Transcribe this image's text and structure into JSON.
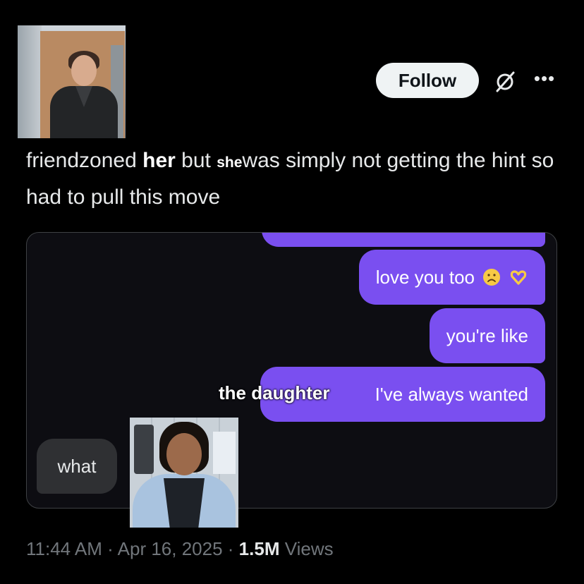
{
  "header": {
    "follow_label": "Follow",
    "grok_icon": "grok-icon",
    "more_icon": "more-horizontal-icon"
  },
  "post": {
    "text_1": "friendzoned",
    "text_her": "her",
    "text_2": "but",
    "text_she": "she",
    "text_3": "was simply not getting the hint so had to pull this move"
  },
  "chat": {
    "sent_messages": [
      {
        "text": "love you too",
        "emojis": [
          "sad-face-emoji",
          "heart-hands-emoji"
        ]
      },
      {
        "text": "you're like"
      },
      {
        "text": "I've always wanted"
      }
    ],
    "overlay_label": "the daughter",
    "received_message": "what",
    "bubble_color": "#7a4ff0",
    "received_color": "#2f3033"
  },
  "meta": {
    "time": "11:44 AM",
    "date": "Apr 16, 2025",
    "views_count": "1.5M",
    "views_label": "Views",
    "separator": "·"
  },
  "colors": {
    "background": "#000000",
    "text": "#e7e9ea",
    "muted": "#71767b"
  }
}
